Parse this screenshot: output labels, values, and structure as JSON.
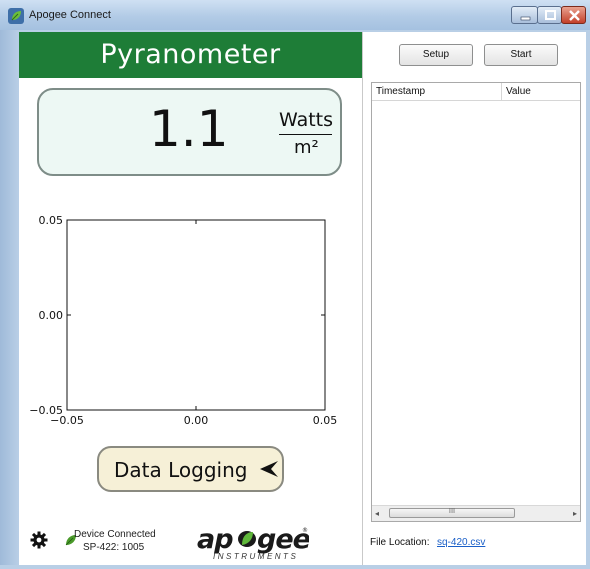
{
  "window": {
    "title": "Apogee Connect",
    "controls": [
      "minimize-icon",
      "maximize-icon",
      "close-icon"
    ]
  },
  "sensor": {
    "title": "Pyranometer",
    "reading": "1.1",
    "unit_numerator": "Watts",
    "unit_denominator": "m²"
  },
  "chart_data": {
    "type": "line",
    "x": [],
    "y": [],
    "xlim": [
      -0.05,
      0.05
    ],
    "ylim": [
      -0.05,
      0.05
    ],
    "xticks": [
      "−0.05",
      "0.00",
      "0.05"
    ],
    "yticks": [
      "0.05",
      "0.00",
      "−0.05"
    ],
    "grid": false
  },
  "logging": {
    "button_label": "Data Logging",
    "icon": "arrow-left-icon"
  },
  "status": {
    "settings_icon": "gear-icon",
    "connection_icon": "leaf-icon",
    "connection_text": "Device Connected",
    "device_text": "SP-422: 1005"
  },
  "logo": {
    "word": "apogee",
    "sub": "INSTRUMENTS"
  },
  "toolbar": {
    "setup_label": "Setup",
    "start_label": "Start"
  },
  "table": {
    "columns": [
      "Timestamp",
      "Value"
    ],
    "rows": [],
    "scroll_grip": "III"
  },
  "file": {
    "label": "File Location:",
    "link": "sq-420.csv"
  },
  "colors": {
    "header_green": "#1e7d37",
    "reading_box": "#edf8f4",
    "logging_button": "#f6f0d7",
    "link_blue": "#1a5fc8"
  }
}
